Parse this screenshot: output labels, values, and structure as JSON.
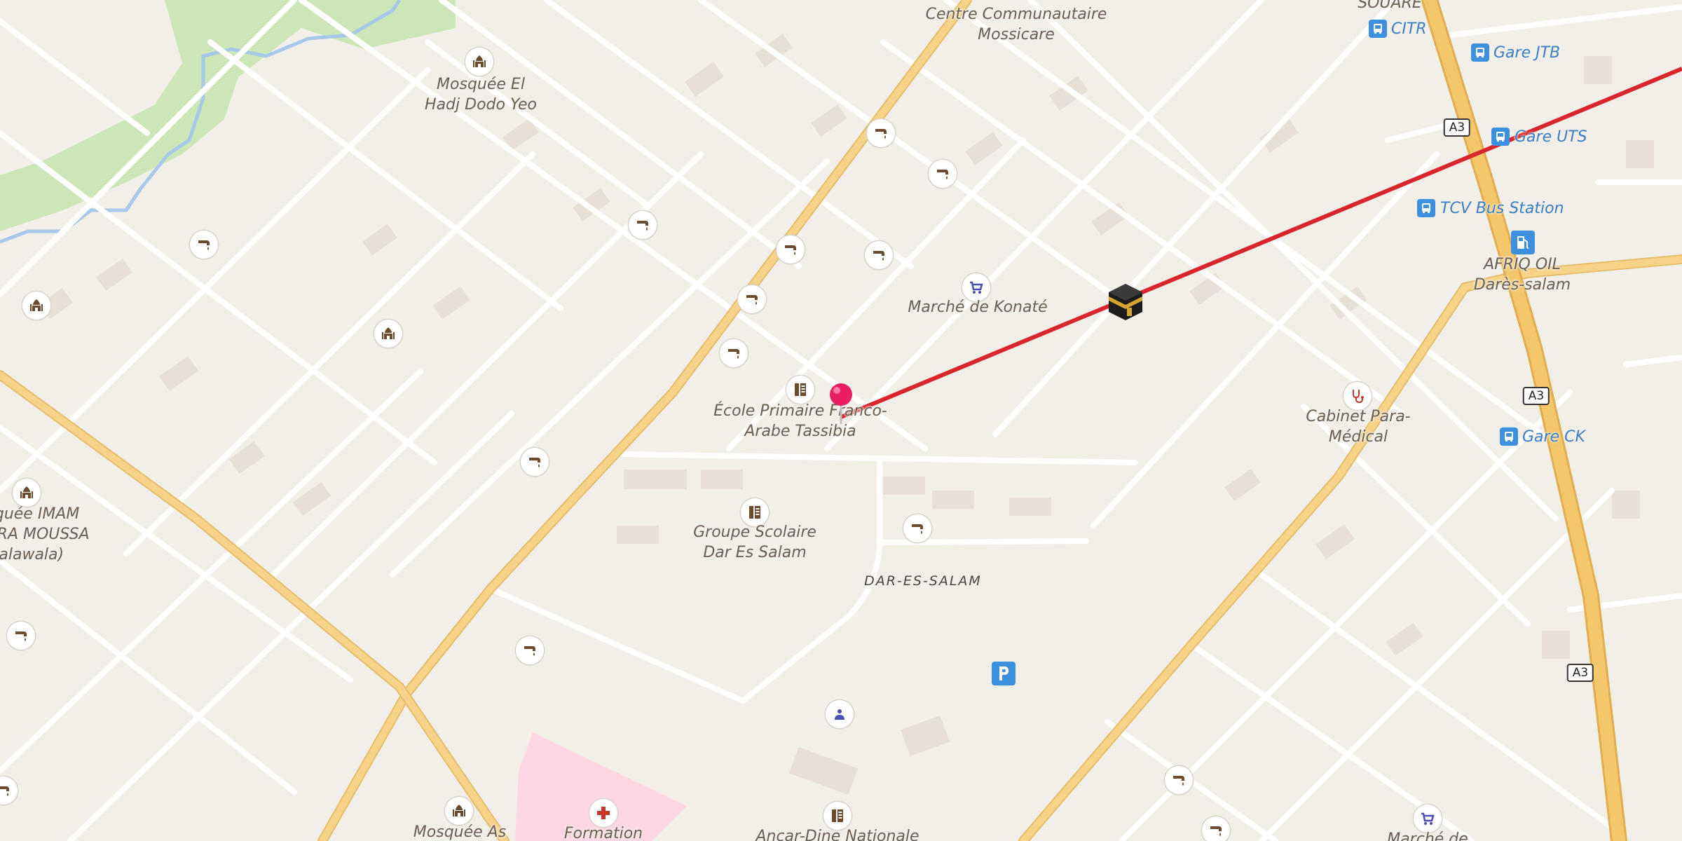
{
  "map": {
    "labels": {
      "centre_communautaire": [
        "Centre Communautaire",
        "Mossicare"
      ],
      "mosquee_el_hadj": [
        "Mosquée El",
        "Hadj Dodo Yeo"
      ],
      "marche_konate": "Marché de Konaté",
      "ecole_primaire": [
        "École Primaire Franco-",
        "Arabe Tassibia"
      ],
      "groupe_scolaire": [
        "Groupe Scolaire",
        "Dar Es Salam"
      ],
      "mosquee_imam": [
        "squée IMAM",
        "RRA MOUSSA",
        "walawala)"
      ],
      "cabinet_para": [
        "Cabinet Para-",
        "Médical"
      ],
      "afriq_oil": [
        "AFRIQ OIL",
        "Darès-salam"
      ],
      "mosquee_as": "Mosquée As",
      "formation": "Formation",
      "ancar_dine": "Ancar-Dine Nationale",
      "marche_de": "Marché de",
      "souare": "SOUARE",
      "district": "DAR-ES-SALAM"
    },
    "transit": {
      "citr": "CITR",
      "gare_jtb": "Gare JTB",
      "gare_uts": "Gare UTS",
      "tcv": "TCV Bus Station",
      "gare_ck": "Gare CK"
    },
    "road_refs": [
      "A3",
      "A3",
      "A3",
      "A3"
    ],
    "icons": {
      "water": "water-tap-icon",
      "mosque": "mosque-icon",
      "school": "school-icon",
      "bus": "bus-stop-icon",
      "fuel": "fuel-station-icon",
      "shop": "marketplace-icon",
      "clinic": "doctor-icon",
      "hospital": "hospital-icon",
      "parking": "parking-icon",
      "pin": "location-pin-icon",
      "qibla": "kaaba-icon"
    },
    "colors": {
      "background": "#f2efe9",
      "primary_road": "#f7d38a",
      "trunk_road": "#f5c76b",
      "street": "#ffffff",
      "water": "#a7c8e8",
      "park": "#cde6b8",
      "hospital_area": "#ffd6e4",
      "qibla_line": "#d9262c",
      "pin": "#e91e63",
      "transit": "#3d8fdf"
    }
  }
}
